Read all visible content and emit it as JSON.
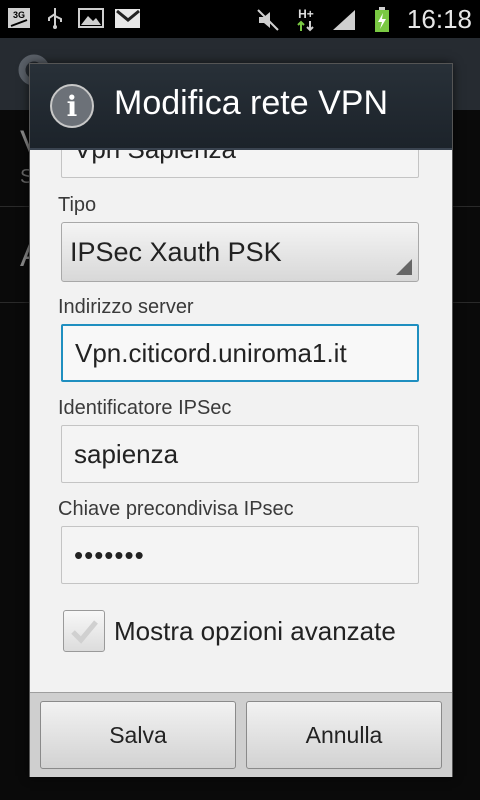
{
  "status_bar": {
    "time": "16:18",
    "network_type": "H+",
    "left_icons": [
      "3g-icon",
      "usb-icon",
      "gallery-icon",
      "gmail-icon"
    ],
    "right_icons": [
      "mute-icon",
      "data-activity-icon",
      "signal-icon",
      "battery-charging-icon"
    ]
  },
  "background": {
    "row1_text": "V",
    "row1_sub": "S",
    "row2_text": "A"
  },
  "dialog": {
    "title": "Modifica rete VPN",
    "name_value": "Vpn Sapienza",
    "type": {
      "label": "Tipo",
      "value": "IPSec Xauth PSK"
    },
    "server": {
      "label": "Indirizzo server",
      "value": "Vpn.citicord.uniroma1.it"
    },
    "ipsec_id": {
      "label": "Identificatore IPSec",
      "value": "sapienza"
    },
    "psk": {
      "label": "Chiave precondivisa IPsec",
      "value": "•••••••"
    },
    "advanced": {
      "label": "Mostra opzioni avanzate",
      "checked": false
    },
    "buttons": {
      "save": "Salva",
      "cancel": "Annulla"
    }
  },
  "colors": {
    "focus_border": "#1f8fc0",
    "title_bar": "#232a31",
    "battery_green": "#7ac943"
  }
}
